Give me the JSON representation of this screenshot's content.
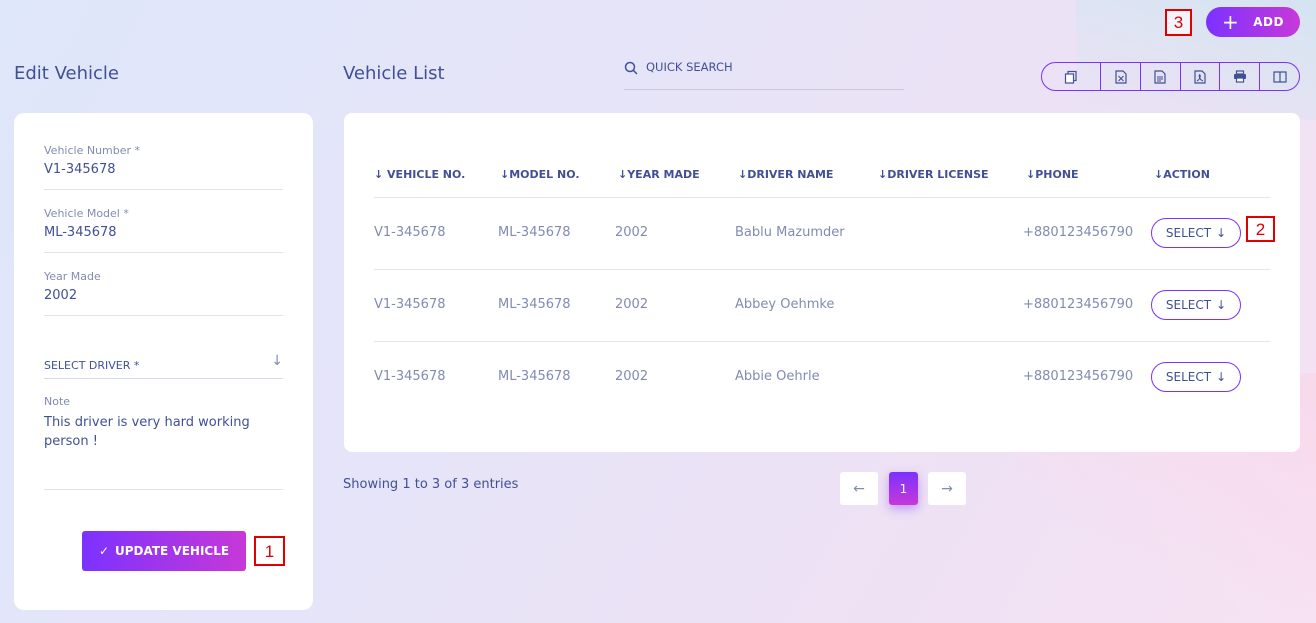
{
  "header": {
    "add_label": "ADD",
    "marker_add": "3"
  },
  "edit": {
    "title": "Edit Vehicle",
    "vehicle_number_label": "Vehicle Number *",
    "vehicle_number": "V1-345678",
    "vehicle_model_label": "Vehicle Model *",
    "vehicle_model": "ML-345678",
    "year_made_label": "Year Made",
    "year_made": "2002",
    "select_driver_label": "SELECT DRIVER *",
    "note_label": "Note",
    "note_value": "This driver is very hard working person !",
    "update_label": "UPDATE VEHICLE",
    "marker_update": "1"
  },
  "list": {
    "title": "Vehicle List",
    "search_placeholder": "QUICK SEARCH",
    "toolbar_icons": [
      "copy-icon",
      "excel-icon",
      "csv-icon",
      "pdf-icon",
      "print-icon",
      "columns-icon"
    ],
    "columns": [
      "VEHICLE NO.",
      "MODEL NO.",
      "YEAR MADE",
      "DRIVER NAME",
      "DRIVER LICENSE",
      "PHONE",
      "ACTION"
    ],
    "rows": [
      {
        "vehicle_no": "V1-345678",
        "model_no": "ML-345678",
        "year": "2002",
        "driver": "Bablu Mazumder",
        "license": "",
        "phone": "+880123456790",
        "action": "SELECT"
      },
      {
        "vehicle_no": "V1-345678",
        "model_no": "ML-345678",
        "year": "2002",
        "driver": "Abbey Oehmke",
        "license": "",
        "phone": "+880123456790",
        "action": "SELECT"
      },
      {
        "vehicle_no": "V1-345678",
        "model_no": "ML-345678",
        "year": "2002",
        "driver": "Abbie Oehrle",
        "license": "",
        "phone": "+880123456790",
        "action": "SELECT"
      }
    ],
    "marker_select": "2",
    "showing": "Showing 1 to 3 of 3 entries",
    "pagination": {
      "prev": "←",
      "current": "1",
      "next": "→"
    }
  },
  "colors": {
    "accent": "#7c32ff",
    "accent2": "#c738d8",
    "text": "#415094",
    "muted": "#828bb2"
  }
}
